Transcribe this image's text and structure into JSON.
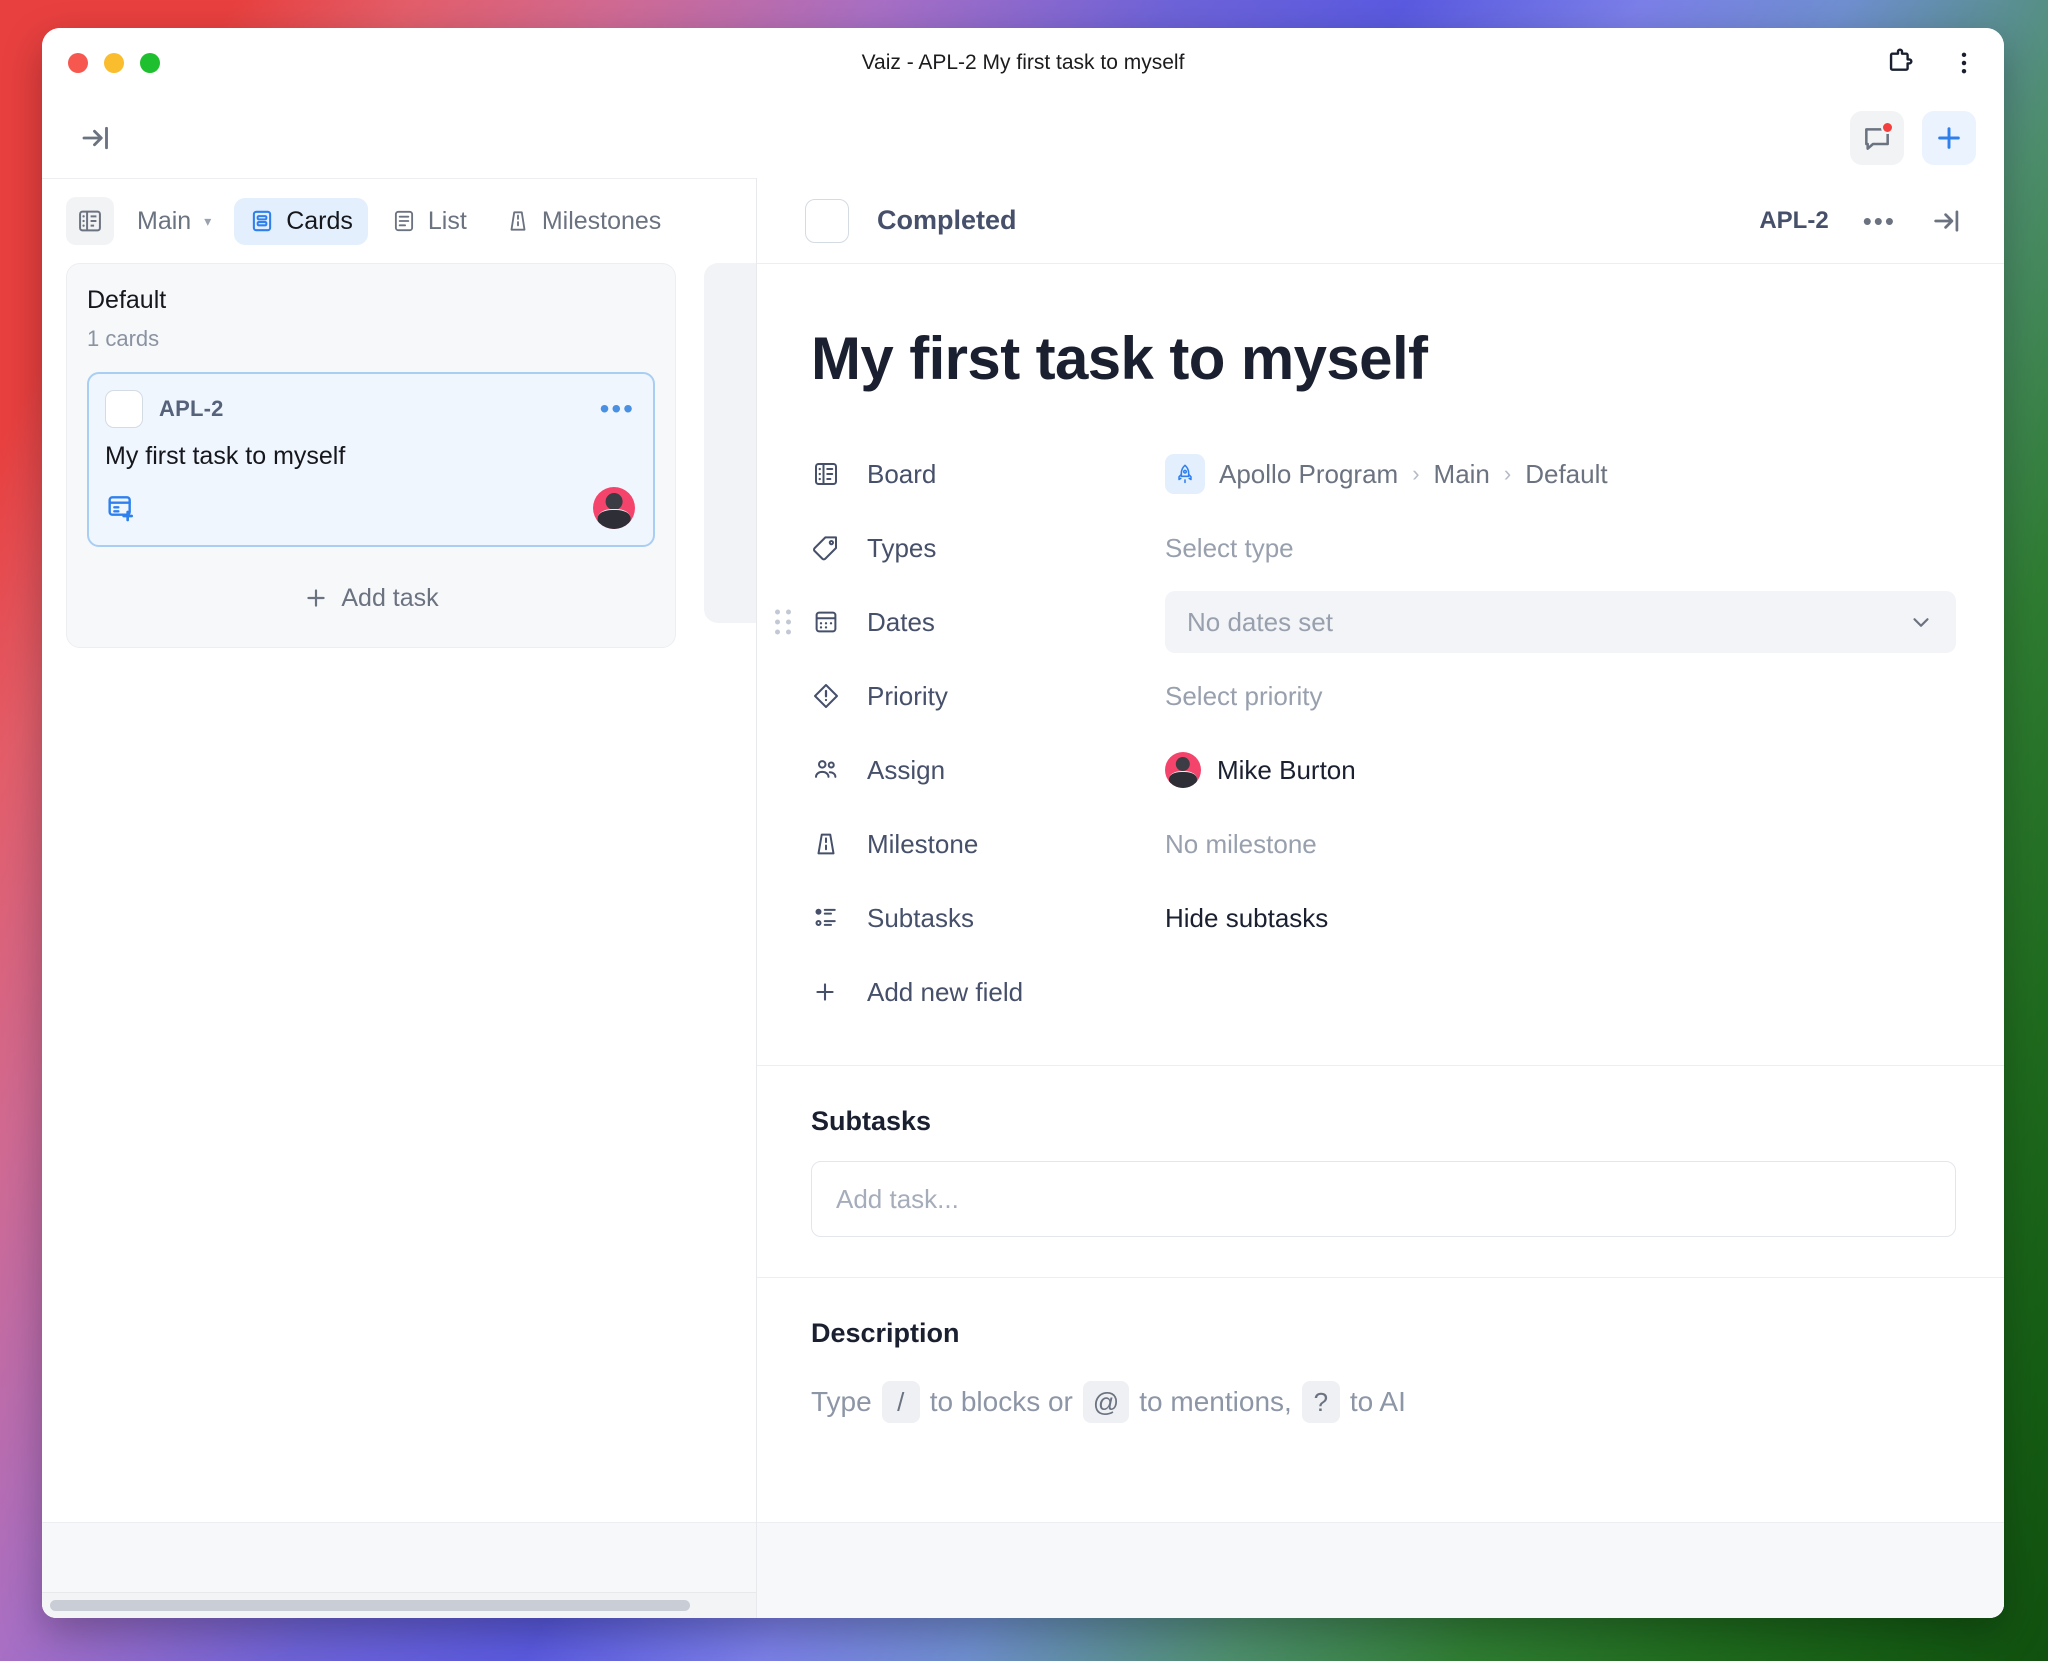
{
  "window": {
    "title": "Vaiz - APL-2 My first task to myself",
    "traffic_lights": [
      "close",
      "minimize",
      "zoom"
    ]
  },
  "browser_toolbar": {
    "extensions_icon": "puzzle-icon",
    "menu_icon": "kebab-menu-icon"
  },
  "app_toolbar": {
    "collapse_icon": "collapse-sidebar-icon",
    "comments_icon": "comment-bubble-icon",
    "has_notification": true,
    "add_icon": "plus-icon"
  },
  "board": {
    "board_icon": "board-grid-icon",
    "selector_label": "Main",
    "selector_caret": "▾",
    "views": [
      {
        "label": "Cards",
        "icon": "cards-view-icon",
        "active": true
      },
      {
        "label": "List",
        "icon": "list-view-icon",
        "active": false
      },
      {
        "label": "Milestones",
        "icon": "milestone-icon",
        "active": false
      }
    ],
    "column": {
      "title": "Default",
      "count_label": "1 cards",
      "add_task_label": "Add task",
      "add_task_icon": "plus-icon",
      "card": {
        "key": "APL-2",
        "title": "My first task to myself",
        "more_icon": "ellipsis-icon",
        "subtask_icon": "add-subtask-icon",
        "checkbox_checked": false,
        "avatar_name": "Mike Burton"
      }
    }
  },
  "detail": {
    "header": {
      "status_label": "Completed",
      "status_checked": false,
      "task_key": "APL-2",
      "more_icon": "ellipsis-icon",
      "close_icon": "collapse-panel-icon"
    },
    "title": "My first task to myself",
    "properties": [
      {
        "label": "Board",
        "icon": "board-grid-icon",
        "type": "breadcrumb",
        "breadcrumb": [
          "Apollo Program",
          "Main",
          "Default"
        ],
        "breadcrumb_icon": "rocket-icon",
        "separator": "›"
      },
      {
        "label": "Types",
        "icon": "tag-icon",
        "type": "placeholder",
        "value": "Select type"
      },
      {
        "label": "Dates",
        "icon": "calendar-icon",
        "type": "select",
        "value": "No dates set",
        "chevron": "chevron-down-icon",
        "has_handle": true
      },
      {
        "label": "Priority",
        "icon": "priority-diamond-icon",
        "type": "placeholder",
        "value": "Select priority"
      },
      {
        "label": "Assign",
        "icon": "people-icon",
        "type": "assignee",
        "value": "Mike Burton"
      },
      {
        "label": "Milestone",
        "icon": "milestone-icon",
        "type": "placeholder",
        "value": "No milestone"
      },
      {
        "label": "Subtasks",
        "icon": "subtasks-icon",
        "type": "text",
        "value": "Hide subtasks"
      }
    ],
    "add_new_field": {
      "label": "Add new field",
      "icon": "plus-icon"
    },
    "subtasks_section": {
      "title": "Subtasks",
      "input_placeholder": "Add task..."
    },
    "description_section": {
      "title": "Description",
      "placeholder_parts": [
        "Type",
        "/",
        "to blocks or",
        "@",
        "to mentions,",
        "?",
        "to AI"
      ]
    }
  },
  "colors": {
    "accent_blue": "#2f80ed",
    "card_bg": "#eff6fe",
    "card_border": "#a9cef3",
    "notification_red": "#f43f3f",
    "avatar_bg": "#f5446b"
  }
}
